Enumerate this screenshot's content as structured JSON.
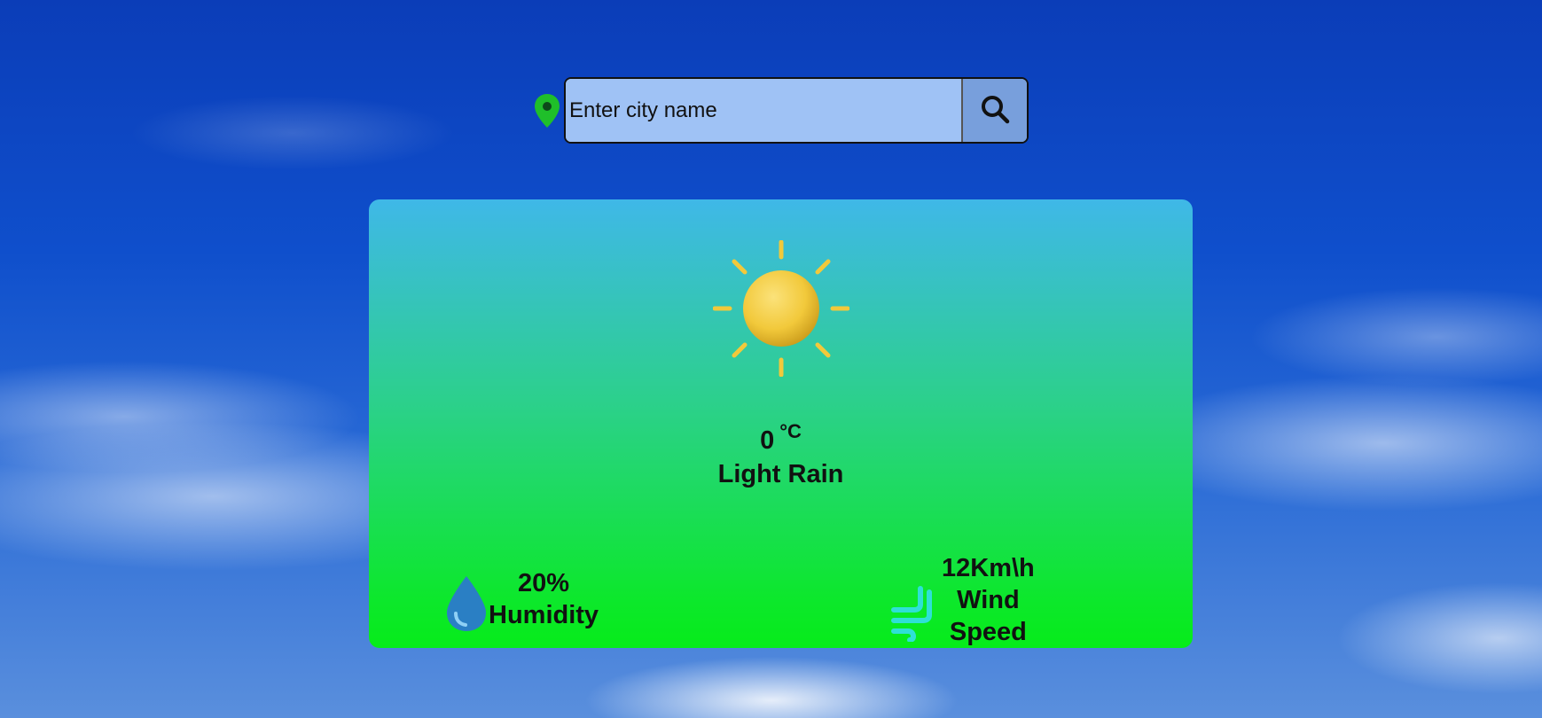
{
  "search": {
    "placeholder": "Enter city name",
    "value": ""
  },
  "icons": {
    "location": "location-pin-icon",
    "search": "search-icon",
    "weather": "sun-icon",
    "humidity": "water-drop-icon",
    "wind": "wind-icon"
  },
  "weather": {
    "temperature": "0",
    "unit": "°C",
    "condition": "Light Rain"
  },
  "humidity": {
    "value": "20%",
    "label": "Humidity"
  },
  "wind": {
    "value": "12Km\\h",
    "label_line1": "Wind",
    "label_line2": "Speed"
  },
  "colors": {
    "pin": "#1fbf2a",
    "search_field": "#9fc2f5",
    "search_button": "#789fdc",
    "card_top": "#3fb8e8",
    "card_bottom": "#06ec1a",
    "drop": "#2a7fc4",
    "wind_icon": "#2ee0d6",
    "sun": "#f2c93b"
  }
}
